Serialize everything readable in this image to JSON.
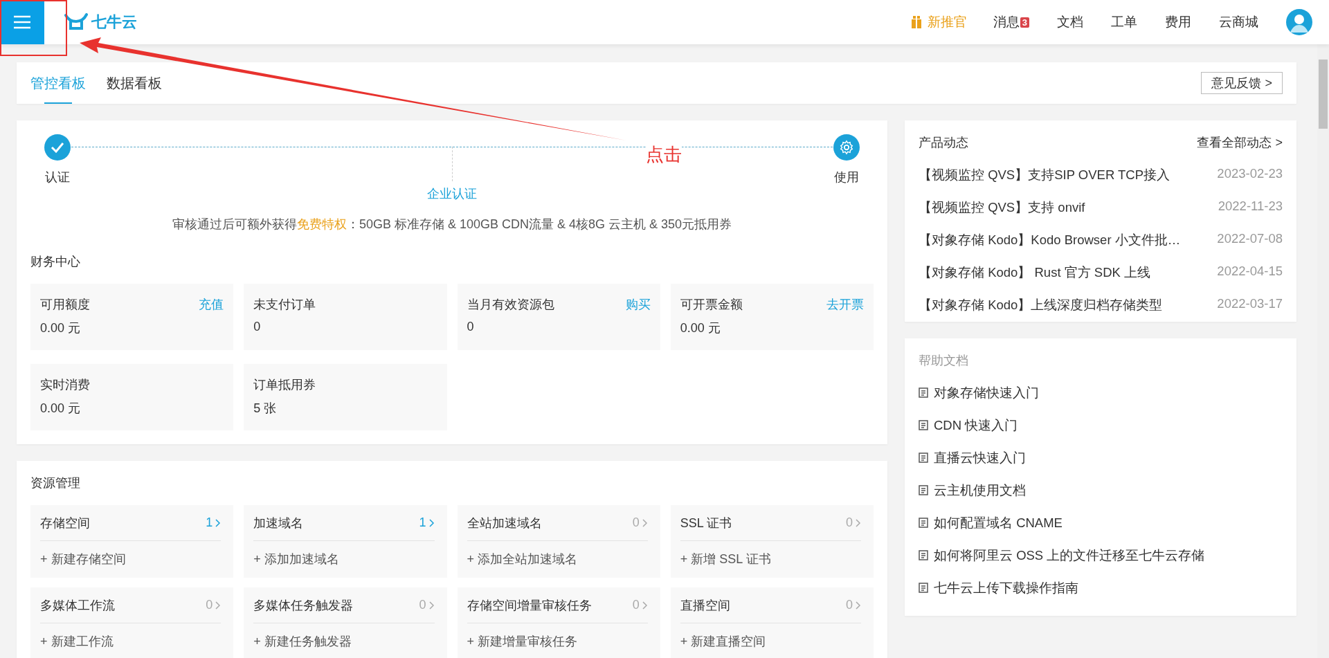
{
  "header": {
    "brand": "七牛云",
    "promo": "新推官",
    "nav": [
      {
        "label": "消息",
        "badge": "3"
      },
      {
        "label": "文档"
      },
      {
        "label": "工单"
      },
      {
        "label": "费用"
      },
      {
        "label": "云商城"
      }
    ]
  },
  "tabs": [
    {
      "label": "管控看板",
      "selected": true
    },
    {
      "label": "数据看板",
      "selected": false
    }
  ],
  "feedback": "意见反馈 >",
  "steps": [
    {
      "label": "认证",
      "kind": "done"
    },
    {
      "label": "企业认证",
      "kind": "current"
    },
    {
      "label": "使用",
      "kind": "goal"
    }
  ],
  "notice": {
    "before": "审核通过后可额外获得",
    "highlight": "免费特权",
    "after": "：50GB 标准存储 & 100GB CDN流量 & 4核8G 云主机 & 350元抵用券"
  },
  "finance": {
    "title": "财务中心",
    "tiles": [
      {
        "label": "可用额度",
        "value": "0.00 元",
        "link": "充值"
      },
      {
        "label": "未支付订单",
        "value": "0"
      },
      {
        "label": "当月有效资源包",
        "value": "0",
        "link": "购买"
      },
      {
        "label": "可开票金额",
        "value": "0.00 元",
        "link": "去开票"
      },
      {
        "label": "实时消费",
        "value": "0.00 元"
      },
      {
        "label": "订单抵用券",
        "value": "5 张"
      }
    ]
  },
  "resources": {
    "title": "资源管理",
    "tiles": [
      {
        "name": "存储空间",
        "count": "1",
        "highlighted": true,
        "action": "+ 新建存储空间"
      },
      {
        "name": "加速域名",
        "count": "1",
        "highlighted": true,
        "action": "+ 添加加速域名"
      },
      {
        "name": "全站加速域名",
        "count": "0",
        "highlighted": false,
        "action": "+ 添加全站加速域名"
      },
      {
        "name": "SSL 证书",
        "count": "0",
        "highlighted": false,
        "action": "+ 新增 SSL 证书"
      },
      {
        "name": "多媒体工作流",
        "count": "0",
        "highlighted": false,
        "action": "+ 新建工作流"
      },
      {
        "name": "多媒体任务触发器",
        "count": "0",
        "highlighted": false,
        "action": "+ 新建任务触发器"
      },
      {
        "name": "存储空间增量审核任务",
        "count": "0",
        "highlighted": false,
        "action": "+ 新建增量审核任务"
      },
      {
        "name": "直播空间",
        "count": "0",
        "highlighted": false,
        "action": "+ 新建直播空间"
      }
    ]
  },
  "news": {
    "title": "产品动态",
    "more": "查看全部动态 >",
    "items": [
      {
        "title": "【视频监控 QVS】支持SIP OVER TCP接入",
        "date": "2023-02-23"
      },
      {
        "title": "【视频监控 QVS】支持 onvif",
        "date": "2022-11-23"
      },
      {
        "title": "【对象存储 Kodo】Kodo Browser 小文件批…",
        "date": "2022-07-08"
      },
      {
        "title": "【对象存储 Kodo】 Rust 官方 SDK 上线",
        "date": "2022-04-15"
      },
      {
        "title": "【对象存储 Kodo】上线深度归档存储类型",
        "date": "2022-03-17"
      }
    ]
  },
  "help": {
    "title": "帮助文档",
    "items": [
      "对象存储快速入门",
      "CDN 快速入门",
      "直播云快速入门",
      "云主机使用文档",
      "如何配置域名 CNAME",
      "如何将阿里云 OSS 上的文件迁移至七牛云存储",
      "七牛云上传下载操作指南"
    ]
  },
  "annotation": {
    "label": "点击"
  }
}
